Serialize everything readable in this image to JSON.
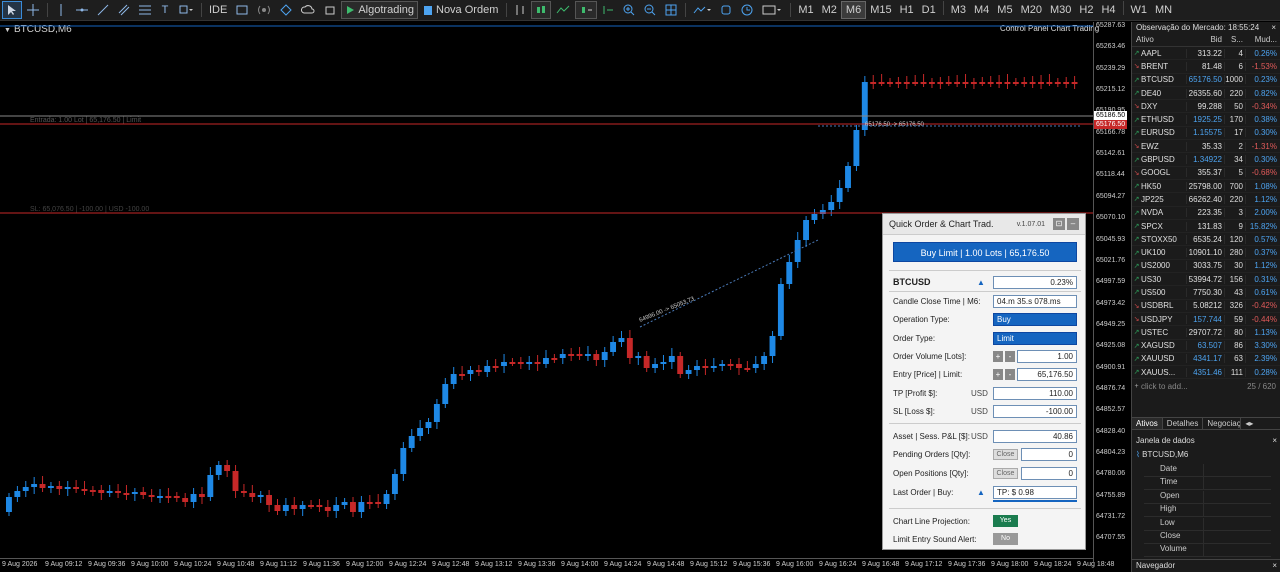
{
  "toolbar": {
    "ide": "IDE",
    "algotrading": "Algotrading",
    "nova_ordem": "Nova Ordem",
    "timeframes": [
      "M1",
      "M2",
      "M6",
      "M15",
      "H1",
      "D1",
      "M3",
      "M4",
      "M5",
      "M20",
      "M30",
      "H2",
      "H4",
      "W1",
      "MN"
    ],
    "selected_tf": "M6"
  },
  "chart": {
    "symbol_title": "BTCUSD,M6",
    "control_panel_label": "Control Panel Chart Trading",
    "entry_line_label": "Entrada: 1.00 Lot | 65,176.50 | Limit",
    "sl_line_label": "SL: 65,076.50 | -100.00 | USD -100.00",
    "tp_projection_label": "65176.50 -> 65176.50",
    "projection_label": "64996.00 -> 65053.73",
    "price_ticks": [
      "65287.63",
      "65263.46",
      "65239.29",
      "65215.12",
      "65190.95",
      "65166.78",
      "65142.61",
      "65118.44",
      "65094.27",
      "65070.10",
      "65045.93",
      "65021.76",
      "64997.59",
      "64973.42",
      "64949.25",
      "64925.08",
      "64900.91",
      "64876.74",
      "64852.57",
      "64828.40",
      "64804.23",
      "64780.06",
      "64755.89",
      "64731.72",
      "64707.55"
    ],
    "price_tag_bid": "65186.50",
    "price_tag_entry": "65176.50",
    "time_ticks": [
      "9 Aug 2026",
      "9 Aug 09:12",
      "9 Aug 09:36",
      "9 Aug 10:00",
      "9 Aug 10:24",
      "9 Aug 10:48",
      "9 Aug 11:12",
      "9 Aug 11:36",
      "9 Aug 12:00",
      "9 Aug 12:24",
      "9 Aug 12:48",
      "9 Aug 13:12",
      "9 Aug 13:36",
      "9 Aug 14:00",
      "9 Aug 14:24",
      "9 Aug 14:48",
      "9 Aug 15:12",
      "9 Aug 15:36",
      "9 Aug 16:00",
      "9 Aug 16:24",
      "9 Aug 16:48",
      "9 Aug 17:12",
      "9 Aug 17:36",
      "9 Aug 18:00",
      "9 Aug 18:24",
      "9 Aug 18:48"
    ],
    "up_color": "#1e88e5",
    "down_color": "#c62828"
  },
  "panel": {
    "title": "Quick Order & Chart Trad.",
    "version": "v.1.07.01",
    "buy_button": "Buy Limit  |  1.00 Lots  |  65,176.50",
    "symbol": "BTCUSD",
    "symbol_change": "0.23%",
    "candle_close_label": "Candle Close Time | M6:",
    "candle_close_value": "04.m 35.s 078.ms",
    "operation_type_label": "Operation Type:",
    "operation_type_value": "Buy",
    "order_type_label": "Order Type:",
    "order_type_value": "Limit",
    "order_volume_label": "Order Volume [Lots]:",
    "order_volume_value": "1.00",
    "entry_label": "Entry [Price] | Limit:",
    "entry_value": "65,176.50",
    "tp_label": "TP [Profit $]:",
    "tp_unit": "USD",
    "tp_value": "110.00",
    "sl_label": "SL [Loss $]:",
    "sl_unit": "USD",
    "sl_value": "-100.00",
    "asset_label": "Asset | Sess. P&L [$]:",
    "asset_unit": "USD",
    "asset_value": "40.86",
    "pending_label": "Pending Orders [Qty]:",
    "pending_value": "0",
    "open_label": "Open Positions [Qty]:",
    "open_value": "0",
    "close_label": "Close",
    "last_order_label": "Last Order | Buy:",
    "last_order_value": "TP: $ 0.98",
    "projection_label": "Chart Line Projection:",
    "projection_value": "Yes",
    "sound_label": "Limit Entry Sound Alert:",
    "sound_value": "No"
  },
  "market_watch": {
    "title": "Observação do Mercado: 18:55:24",
    "col_symbol": "Ativo",
    "col_bid": "Bid",
    "col_spread": "S...",
    "col_change": "Mud...",
    "rows": [
      {
        "sym": "AAPL",
        "bid": "313.22",
        "spr": "4",
        "chg": "0.26%",
        "dir": "up",
        "bidc": "w"
      },
      {
        "sym": "BRENT",
        "bid": "81.48",
        "spr": "6",
        "chg": "-1.53%",
        "dir": "dn",
        "bidc": "w"
      },
      {
        "sym": "BTCUSD",
        "bid": "65176.50",
        "spr": "1000",
        "chg": "0.23%",
        "dir": "up",
        "bidc": "b"
      },
      {
        "sym": "DE40",
        "bid": "26355.60",
        "spr": "220",
        "chg": "0.82%",
        "dir": "up",
        "bidc": "w"
      },
      {
        "sym": "DXY",
        "bid": "99.288",
        "spr": "50",
        "chg": "-0.34%",
        "dir": "dn",
        "bidc": "w"
      },
      {
        "sym": "ETHUSD",
        "bid": "1925.25",
        "spr": "170",
        "chg": "0.38%",
        "dir": "up",
        "bidc": "b"
      },
      {
        "sym": "EURUSD",
        "bid": "1.15575",
        "spr": "17",
        "chg": "0.30%",
        "dir": "up",
        "bidc": "b"
      },
      {
        "sym": "EWZ",
        "bid": "35.33",
        "spr": "2",
        "chg": "-1.31%",
        "dir": "dn",
        "bidc": "w"
      },
      {
        "sym": "GBPUSD",
        "bid": "1.34922",
        "spr": "34",
        "chg": "0.30%",
        "dir": "up",
        "bidc": "b"
      },
      {
        "sym": "GOOGL",
        "bid": "355.37",
        "spr": "5",
        "chg": "-0.68%",
        "dir": "dn",
        "bidc": "w"
      },
      {
        "sym": "HK50",
        "bid": "25798.00",
        "spr": "700",
        "chg": "1.08%",
        "dir": "up",
        "bidc": "w"
      },
      {
        "sym": "JP225",
        "bid": "66262.40",
        "spr": "220",
        "chg": "1.12%",
        "dir": "up",
        "bidc": "w"
      },
      {
        "sym": "NVDA",
        "bid": "223.35",
        "spr": "3",
        "chg": "2.00%",
        "dir": "up",
        "bidc": "w"
      },
      {
        "sym": "SPCX",
        "bid": "131.83",
        "spr": "9",
        "chg": "15.82%",
        "dir": "up",
        "bidc": "w"
      },
      {
        "sym": "STOXX50",
        "bid": "6535.24",
        "spr": "120",
        "chg": "0.57%",
        "dir": "up",
        "bidc": "w"
      },
      {
        "sym": "UK100",
        "bid": "10901.10",
        "spr": "280",
        "chg": "0.37%",
        "dir": "up",
        "bidc": "w"
      },
      {
        "sym": "US2000",
        "bid": "3033.75",
        "spr": "30",
        "chg": "1.12%",
        "dir": "up",
        "bidc": "w"
      },
      {
        "sym": "US30",
        "bid": "53994.72",
        "spr": "156",
        "chg": "0.31%",
        "dir": "up",
        "bidc": "w"
      },
      {
        "sym": "US500",
        "bid": "7750.30",
        "spr": "43",
        "chg": "0.61%",
        "dir": "up",
        "bidc": "w"
      },
      {
        "sym": "USDBRL",
        "bid": "5.08212",
        "spr": "326",
        "chg": "-0.42%",
        "dir": "dn",
        "bidc": "w"
      },
      {
        "sym": "USDJPY",
        "bid": "157.744",
        "spr": "59",
        "chg": "-0.44%",
        "dir": "dn",
        "bidc": "b"
      },
      {
        "sym": "USTEC",
        "bid": "29707.72",
        "spr": "80",
        "chg": "1.13%",
        "dir": "up",
        "bidc": "w"
      },
      {
        "sym": "XAGUSD",
        "bid": "63.507",
        "spr": "86",
        "chg": "3.30%",
        "dir": "up",
        "bidc": "b"
      },
      {
        "sym": "XAUUSD",
        "bid": "4341.17",
        "spr": "63",
        "chg": "2.39%",
        "dir": "up",
        "bidc": "b"
      },
      {
        "sym": "XAUUS...",
        "bid": "4351.46",
        "spr": "111",
        "chg": "0.28%",
        "dir": "up",
        "bidc": "b"
      }
    ],
    "add_label": "click to add...",
    "count": "25 / 620",
    "tabs": [
      "Ativos",
      "Detalhes",
      "Negociação"
    ]
  },
  "data_window": {
    "title": "Janela de dados",
    "symbol": "BTCUSD,M6",
    "rows": [
      "Date",
      "Time",
      "Open",
      "High",
      "Low",
      "Close",
      "Volume"
    ]
  },
  "navigator": {
    "title": "Navegador"
  }
}
